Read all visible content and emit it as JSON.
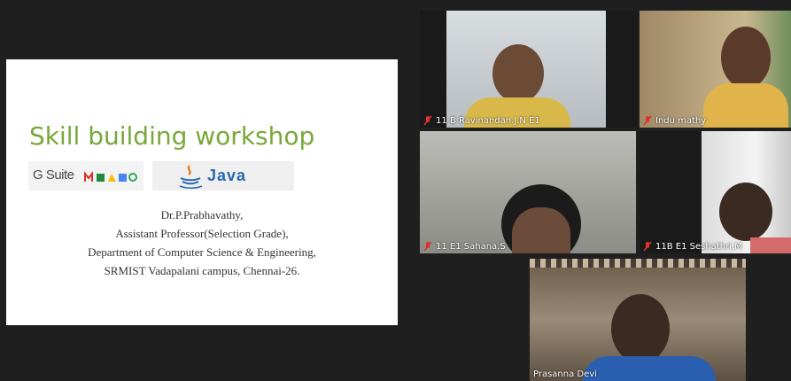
{
  "slide": {
    "title": "Skill building workshop",
    "gsuite_logo_text": "G Suite",
    "java_logo_text": "Java",
    "author_lines": [
      "Dr.P.Prabhavathy,",
      "Assistant Professor(Selection Grade),",
      "Department of Computer Science & Engineering,",
      "SRMIST Vadapalani campus, Chennai-26."
    ]
  },
  "participants": [
    {
      "name": "11 B Ravinandan.J.N E1",
      "muted": true
    },
    {
      "name": "Indu mathy",
      "muted": true
    },
    {
      "name": "11 E1 Sahana.S",
      "muted": true
    },
    {
      "name": "11B E1 Seshathri.M",
      "muted": true
    },
    {
      "name": "Prasanna Devi",
      "muted": false
    }
  ],
  "colors": {
    "background": "#1f1f1f",
    "title_green": "#78a83a",
    "muted_red": "#e0312b",
    "java_blue": "#2769b0"
  }
}
